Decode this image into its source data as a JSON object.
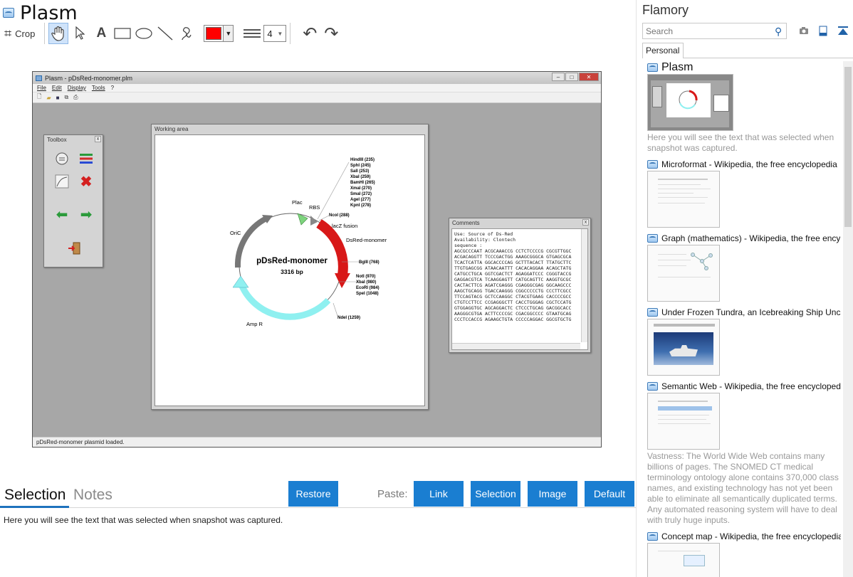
{
  "app": {
    "title": "Plasm"
  },
  "toolbar": {
    "crop_label": "Crop",
    "tools": [
      "hand-tool",
      "pointer-tool",
      "text-tool",
      "rectangle-tool",
      "ellipse-tool",
      "line-tool",
      "freehand-tool"
    ],
    "text_tool_glyph": "A",
    "color": "#ff0000",
    "line_width": "4"
  },
  "screenshot": {
    "window_title": "Plasm - pDsRed-monomer.plm",
    "menu": [
      "File",
      "Edit",
      "Display",
      "Tools",
      "?"
    ],
    "toolbox_title": "Toolbox",
    "working_area_title": "Working area",
    "comments_title": "Comments",
    "comments_lines": [
      "Use: Source of Ds-Red",
      "",
      "Availability: Clontech",
      "",
      "sequence :",
      "AGCGCCCAAT ACGCAAACCG CCTCTCCCCG CGCGTTGGC",
      "ACGACAGGTT TCCCGACTGG AAAGCGGGCA GTGAGCGCA",
      "TCACTCATTA GGCACCCCAG GCTTTACACT TTATGCTTC",
      "TTGTGAGCGG ATAACAATTT CACACAGGAA ACAGCTATG",
      "CATGCCTGCA GGTCGACTCT AGAGGATCCC CGGGTACCG",
      "GAGGACGTCA TCAAGGAGTT CATGCAGTTC AAGGTGCGC",
      "CACTACTTCG AGATCGAGGG CGAGGGCGAG GGCAAGCCC",
      "AAGCTGCAGG TGACCAAGGG CGGCCCCCTG CCCTTCGCC",
      "TTCCAGTACG GCTCCAAGGC CTACGTGAAG CACCCCGCC",
      "CTGTCCTTCC CCGAGGGCTT CACCTGGGAG CGCTCCATG",
      "GTGGAGGTGC AGCAGGACTC CTCCCTGCAG GACGGCACC",
      "AAGGGCGTGA ACTTCCCCGC CGACGGCCCC GTAATGCAG",
      "CCCTCCACCG AGAAGCTGTA CCCCCAGGAC GGCGTGCTG"
    ],
    "status": "pDsRed-monomer plasmid loaded.",
    "plasmid": {
      "name": "pDsRed-monomer",
      "size": "3316 bp",
      "features": [
        "Plac",
        "RBS",
        "lacZ fusion",
        "DsRed-monomer",
        "OriC",
        "Amp R"
      ],
      "sites": [
        "HindIII (235)",
        "SphI (245)",
        "SalI (253)",
        "XbaI (259)",
        "BamHI (265)",
        "XmaI (270)",
        "SmaI (272)",
        "AgeI (277)",
        "KpnI (278)",
        "NcoI (288)",
        "BglII (768)",
        "NotI (970)",
        "XbaI (980)",
        "EcoRI (984)",
        "SpeI (1048)",
        "NdeI (1259)"
      ]
    }
  },
  "tabs": {
    "selection": "Selection",
    "notes": "Notes"
  },
  "buttons": {
    "restore": "Restore",
    "paste_label": "Paste:",
    "link": "Link",
    "selection": "Selection",
    "image": "Image",
    "default": "Default"
  },
  "selection_text": "Here you will see the text that was selected when snapshot was captured.",
  "sidebar": {
    "title": "Flamory",
    "search_placeholder": "Search",
    "tab": "Personal",
    "snapshots": [
      {
        "title": "Plasm",
        "desc": "Here you will see the text that was selected when snapshot was captured."
      },
      {
        "title": "Microformat - Wikipedia, the free encyclopedia",
        "desc": ""
      },
      {
        "title": "Graph (mathematics) - Wikipedia, the free ency",
        "desc": ""
      },
      {
        "title": "Under Frozen Tundra, an Icebreaking Ship Unco",
        "desc": ""
      },
      {
        "title": "Semantic Web - Wikipedia, the free encycloped",
        "desc": "Vastness: The World Wide Web contains many billions of pages. The SNOMED CT medical terminology ontology alone contains 370,000 class names, and existing technology has not yet been able to eliminate all semantically duplicated terms. Any automated reasoning system will have to deal with truly huge inputs."
      },
      {
        "title": "Concept map - Wikipedia, the free encyclopedia",
        "desc": ""
      }
    ]
  }
}
